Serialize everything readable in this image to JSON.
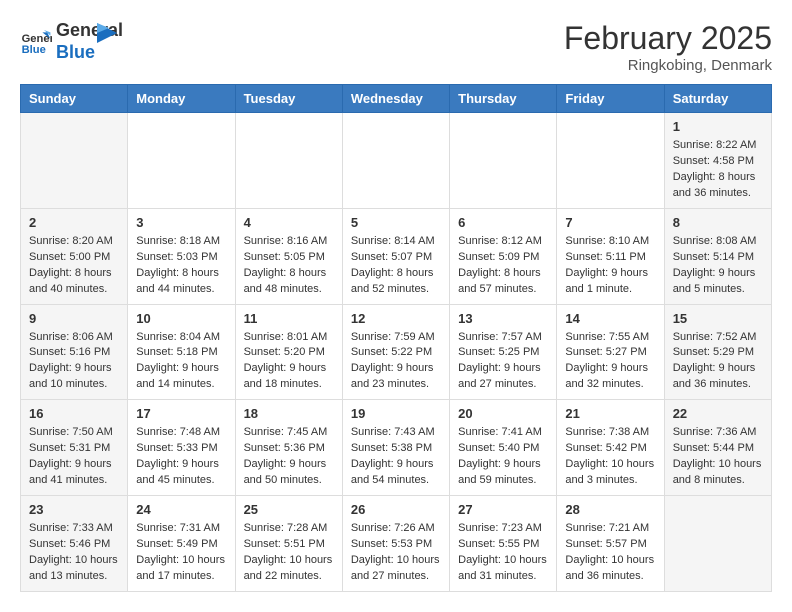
{
  "header": {
    "logo_general": "General",
    "logo_blue": "Blue",
    "month_year": "February 2025",
    "location": "Ringkobing, Denmark"
  },
  "days_of_week": [
    "Sunday",
    "Monday",
    "Tuesday",
    "Wednesday",
    "Thursday",
    "Friday",
    "Saturday"
  ],
  "weeks": [
    [
      {
        "day": "",
        "info": ""
      },
      {
        "day": "",
        "info": ""
      },
      {
        "day": "",
        "info": ""
      },
      {
        "day": "",
        "info": ""
      },
      {
        "day": "",
        "info": ""
      },
      {
        "day": "",
        "info": ""
      },
      {
        "day": "1",
        "info": "Sunrise: 8:22 AM\nSunset: 4:58 PM\nDaylight: 8 hours and 36 minutes."
      }
    ],
    [
      {
        "day": "2",
        "info": "Sunrise: 8:20 AM\nSunset: 5:00 PM\nDaylight: 8 hours and 40 minutes."
      },
      {
        "day": "3",
        "info": "Sunrise: 8:18 AM\nSunset: 5:03 PM\nDaylight: 8 hours and 44 minutes."
      },
      {
        "day": "4",
        "info": "Sunrise: 8:16 AM\nSunset: 5:05 PM\nDaylight: 8 hours and 48 minutes."
      },
      {
        "day": "5",
        "info": "Sunrise: 8:14 AM\nSunset: 5:07 PM\nDaylight: 8 hours and 52 minutes."
      },
      {
        "day": "6",
        "info": "Sunrise: 8:12 AM\nSunset: 5:09 PM\nDaylight: 8 hours and 57 minutes."
      },
      {
        "day": "7",
        "info": "Sunrise: 8:10 AM\nSunset: 5:11 PM\nDaylight: 9 hours and 1 minute."
      },
      {
        "day": "8",
        "info": "Sunrise: 8:08 AM\nSunset: 5:14 PM\nDaylight: 9 hours and 5 minutes."
      }
    ],
    [
      {
        "day": "9",
        "info": "Sunrise: 8:06 AM\nSunset: 5:16 PM\nDaylight: 9 hours and 10 minutes."
      },
      {
        "day": "10",
        "info": "Sunrise: 8:04 AM\nSunset: 5:18 PM\nDaylight: 9 hours and 14 minutes."
      },
      {
        "day": "11",
        "info": "Sunrise: 8:01 AM\nSunset: 5:20 PM\nDaylight: 9 hours and 18 minutes."
      },
      {
        "day": "12",
        "info": "Sunrise: 7:59 AM\nSunset: 5:22 PM\nDaylight: 9 hours and 23 minutes."
      },
      {
        "day": "13",
        "info": "Sunrise: 7:57 AM\nSunset: 5:25 PM\nDaylight: 9 hours and 27 minutes."
      },
      {
        "day": "14",
        "info": "Sunrise: 7:55 AM\nSunset: 5:27 PM\nDaylight: 9 hours and 32 minutes."
      },
      {
        "day": "15",
        "info": "Sunrise: 7:52 AM\nSunset: 5:29 PM\nDaylight: 9 hours and 36 minutes."
      }
    ],
    [
      {
        "day": "16",
        "info": "Sunrise: 7:50 AM\nSunset: 5:31 PM\nDaylight: 9 hours and 41 minutes."
      },
      {
        "day": "17",
        "info": "Sunrise: 7:48 AM\nSunset: 5:33 PM\nDaylight: 9 hours and 45 minutes."
      },
      {
        "day": "18",
        "info": "Sunrise: 7:45 AM\nSunset: 5:36 PM\nDaylight: 9 hours and 50 minutes."
      },
      {
        "day": "19",
        "info": "Sunrise: 7:43 AM\nSunset: 5:38 PM\nDaylight: 9 hours and 54 minutes."
      },
      {
        "day": "20",
        "info": "Sunrise: 7:41 AM\nSunset: 5:40 PM\nDaylight: 9 hours and 59 minutes."
      },
      {
        "day": "21",
        "info": "Sunrise: 7:38 AM\nSunset: 5:42 PM\nDaylight: 10 hours and 3 minutes."
      },
      {
        "day": "22",
        "info": "Sunrise: 7:36 AM\nSunset: 5:44 PM\nDaylight: 10 hours and 8 minutes."
      }
    ],
    [
      {
        "day": "23",
        "info": "Sunrise: 7:33 AM\nSunset: 5:46 PM\nDaylight: 10 hours and 13 minutes."
      },
      {
        "day": "24",
        "info": "Sunrise: 7:31 AM\nSunset: 5:49 PM\nDaylight: 10 hours and 17 minutes."
      },
      {
        "day": "25",
        "info": "Sunrise: 7:28 AM\nSunset: 5:51 PM\nDaylight: 10 hours and 22 minutes."
      },
      {
        "day": "26",
        "info": "Sunrise: 7:26 AM\nSunset: 5:53 PM\nDaylight: 10 hours and 27 minutes."
      },
      {
        "day": "27",
        "info": "Sunrise: 7:23 AM\nSunset: 5:55 PM\nDaylight: 10 hours and 31 minutes."
      },
      {
        "day": "28",
        "info": "Sunrise: 7:21 AM\nSunset: 5:57 PM\nDaylight: 10 hours and 36 minutes."
      },
      {
        "day": "",
        "info": ""
      }
    ]
  ]
}
